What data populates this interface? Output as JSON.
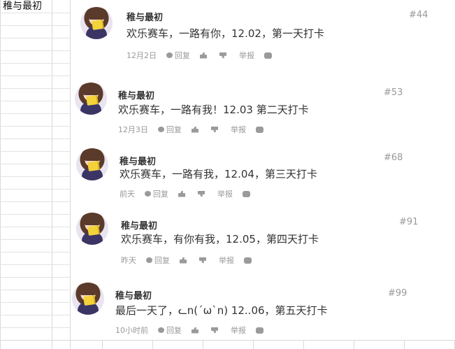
{
  "sheet": {
    "cell_a1": "稚与最初"
  },
  "comments": [
    {
      "name": "稚与最初",
      "text": "欢乐赛车，一路有你，12.02，第一天打卡",
      "floor": "#44",
      "time": "12月2日",
      "reply": "回复",
      "report": "举报"
    },
    {
      "name": "稚与最初",
      "text": "欢乐赛车，一路有我！12.03 第二天打卡",
      "floor": "#53",
      "time": "12月3日",
      "reply": "回复",
      "report": "举报"
    },
    {
      "name": "稚与最初",
      "text": "欢乐赛车，一路有我，12.04，第三天打卡",
      "floor": "#68",
      "time": "前天",
      "reply": "回复",
      "report": "举报"
    },
    {
      "name": "稚与最初",
      "text": "欢乐赛车，有你有我，12.05，第四天打卡",
      "floor": "#91",
      "time": "昨天",
      "reply": "回复",
      "report": "举报"
    },
    {
      "name": "稚与最初",
      "text": "最后一天了，ᓚn(ˊωˋn)  12..06，第五天打卡",
      "floor": "#99",
      "time": "10小时前",
      "reply": "回复",
      "report": "举报"
    }
  ]
}
